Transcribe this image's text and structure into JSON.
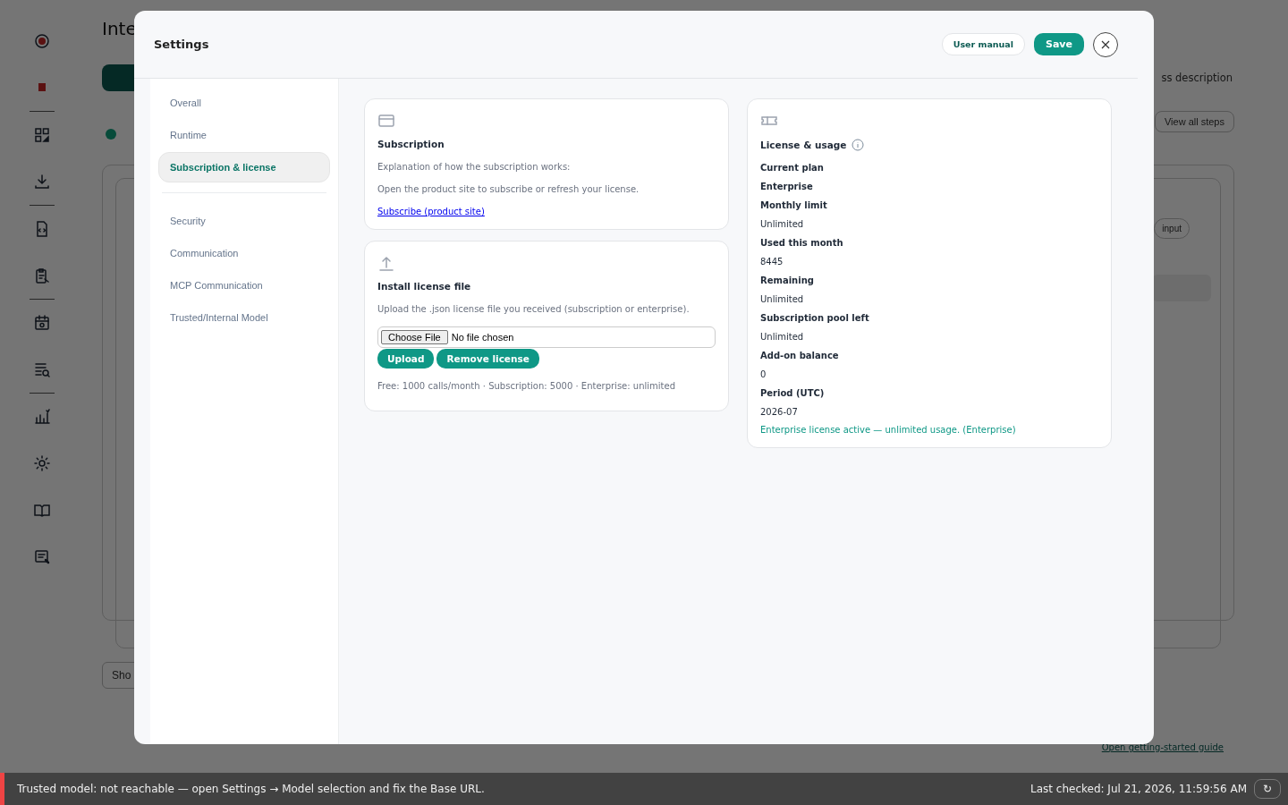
{
  "background": {
    "title": "Inte",
    "description": "ss description",
    "steps_button": "View all steps",
    "chip": "input",
    "show_button": "Sho",
    "guide_link": "Open getting-started guide"
  },
  "modal": {
    "title": "Settings",
    "user_manual": "User manual",
    "save": "Save",
    "nav_groups": [
      [
        {
          "label": "Overall",
          "selected": false
        },
        {
          "label": "Runtime",
          "selected": false
        },
        {
          "label": "Subscription & license",
          "selected": true
        }
      ],
      [
        {
          "label": "Security",
          "selected": false
        },
        {
          "label": "Communication",
          "selected": false
        },
        {
          "label": "MCP Communication",
          "selected": false
        },
        {
          "label": "Trusted/Internal Model",
          "selected": false
        }
      ]
    ],
    "subscription": {
      "title": "Subscription",
      "lines": [
        "Explanation of how the subscription works:",
        "Open the product site to subscribe or refresh your license."
      ],
      "link": "Subscribe (product site)"
    },
    "install": {
      "title": "Install license file",
      "description": "Upload the .json license file you received (subscription or enterprise).",
      "file_button": "Choose File",
      "file_status": "No file chosen",
      "buttons": [
        "Upload",
        "Remove license"
      ],
      "note": "Free: 1000 calls/month · Subscription: 5000 · Enterprise: unlimited"
    },
    "license": {
      "title": "License & usage",
      "fields": [
        {
          "label": "Current plan",
          "value": "Enterprise",
          "value_bold": true
        },
        {
          "label": "Monthly limit",
          "value": "Unlimited",
          "value_bold": false
        },
        {
          "label": "Used this month",
          "value": "8445",
          "value_bold": false
        },
        {
          "label": "Remaining",
          "value": "Unlimited",
          "value_bold": false
        },
        {
          "label": "Subscription pool left",
          "value": "Unlimited",
          "value_bold": false
        },
        {
          "label": "Add-on balance",
          "value": "0",
          "value_bold": false
        },
        {
          "label": "Period (UTC)",
          "value": "2026-07",
          "value_bold": false
        }
      ],
      "status": "Enterprise license active — unlimited usage. (Enterprise)"
    }
  },
  "status_bar": {
    "message": "Trusted model: not reachable — open Settings → Model selection and fix the Base URL.",
    "last_checked": "Last checked: Jul 21, 2026, 11:59:56 AM",
    "refresh": "↻"
  }
}
